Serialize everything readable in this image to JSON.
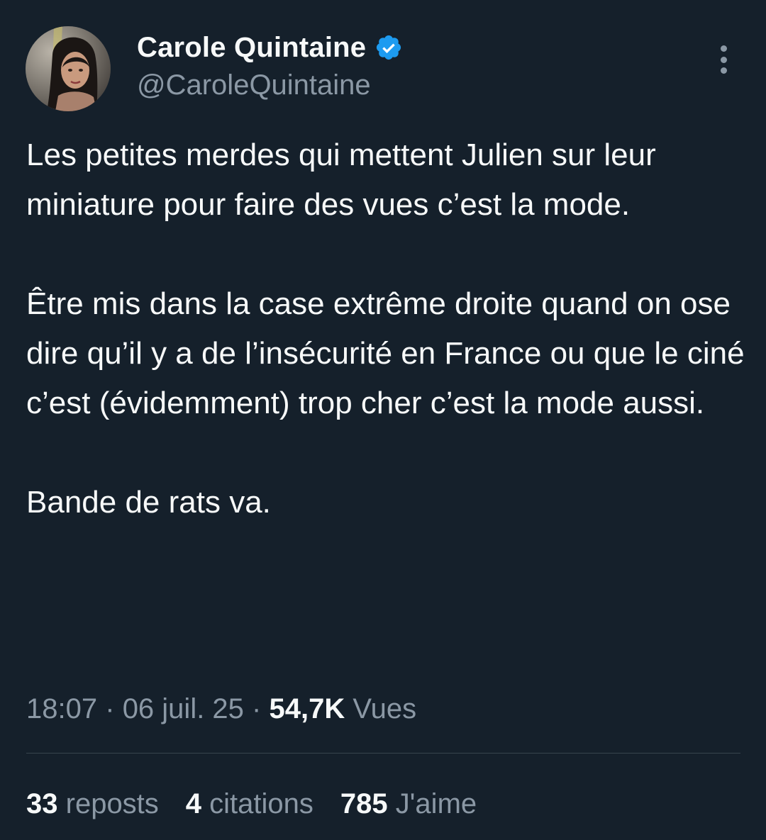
{
  "colors": {
    "background": "#15202b",
    "text_primary": "#f7f9f9",
    "text_secondary": "#8b98a5",
    "verified_badge": "#1d9bf0",
    "divider": "#38444d"
  },
  "author": {
    "display_name": "Carole Quintaine",
    "handle": "@CaroleQuintaine",
    "verified": true,
    "avatar_icon": "profile-photo"
  },
  "more_icon": "more-vertical-icon",
  "tweet": {
    "paragraphs": [
      "Les petites merdes qui mettent Julien sur leur miniature pour faire des vues c’est la mode.",
      "Être mis dans la case extrême droite quand on ose dire qu’il y a de l’insécurité en France ou que le ciné c’est (évidemment) trop cher c’est la mode aussi.",
      "Bande de rats va."
    ]
  },
  "meta": {
    "time": "18:07",
    "separator": "·",
    "date": "06 juil. 25",
    "views_count": "54,7K",
    "views_label": "Vues"
  },
  "stats": {
    "reposts": {
      "count": "33",
      "label": "reposts"
    },
    "quotes": {
      "count": "4",
      "label": "citations"
    },
    "likes": {
      "count": "785",
      "label": "J'aime"
    }
  }
}
